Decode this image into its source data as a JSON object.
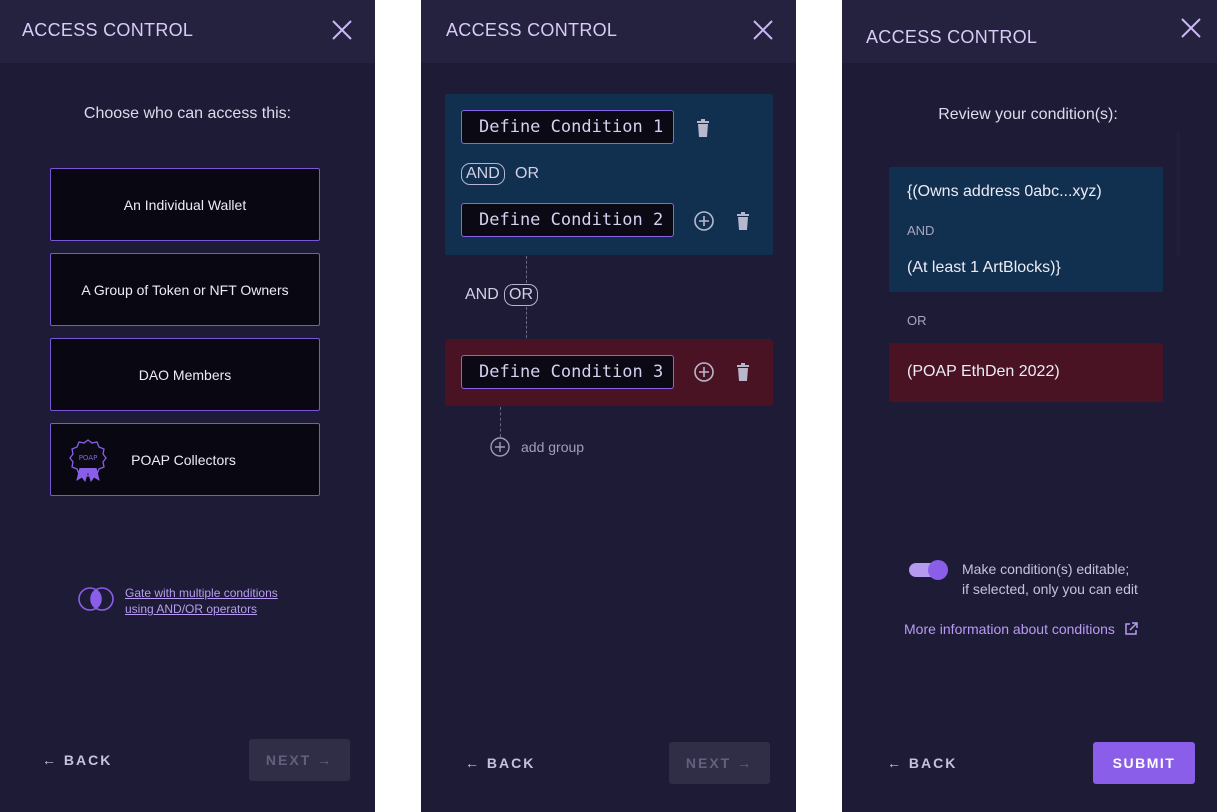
{
  "panel1": {
    "title": "ACCESS CONTROL",
    "prompt": "Choose who can access this:",
    "options": [
      "An Individual Wallet",
      "A Group of Token or NFT Owners",
      "DAO Members",
      "POAP Collectors"
    ],
    "poap_badge_text": "POAP",
    "gate_link_line1": "Gate with multiple conditions",
    "gate_link_line2": "using AND/OR operators",
    "back": "← BACK",
    "next": "NEXT →"
  },
  "panel2": {
    "title": "ACCESS CONTROL",
    "cond1": "Define Condition 1",
    "cond2": "Define Condition 2",
    "cond3": "Define Condition 3",
    "inner_and": "AND",
    "inner_or": "OR",
    "outer_and": "AND",
    "outer_or": "OR",
    "add_group": "add group",
    "back": "← BACK",
    "next": "NEXT →"
  },
  "panel3": {
    "title": "ACCESS CONTROL",
    "prompt": "Review your condition(s):",
    "line1": "{(Owns address 0abc...xyz)",
    "and": "AND",
    "line2": "(At least 1 ArtBlocks)}",
    "or": "OR",
    "line3": "(POAP EthDen 2022)",
    "toggle_line1": "Make condition(s) editable;",
    "toggle_line2": "if selected, only you can edit",
    "more_info": "More information about conditions",
    "back": "← BACK",
    "submit": "SUBMIT"
  },
  "colors": {
    "panel_bg": "#1d1b36",
    "header_bg": "#25223f",
    "accent": "#8a5ee8",
    "group_blue": "#11304f",
    "group_red": "#4a1324"
  },
  "toggle_on": true
}
